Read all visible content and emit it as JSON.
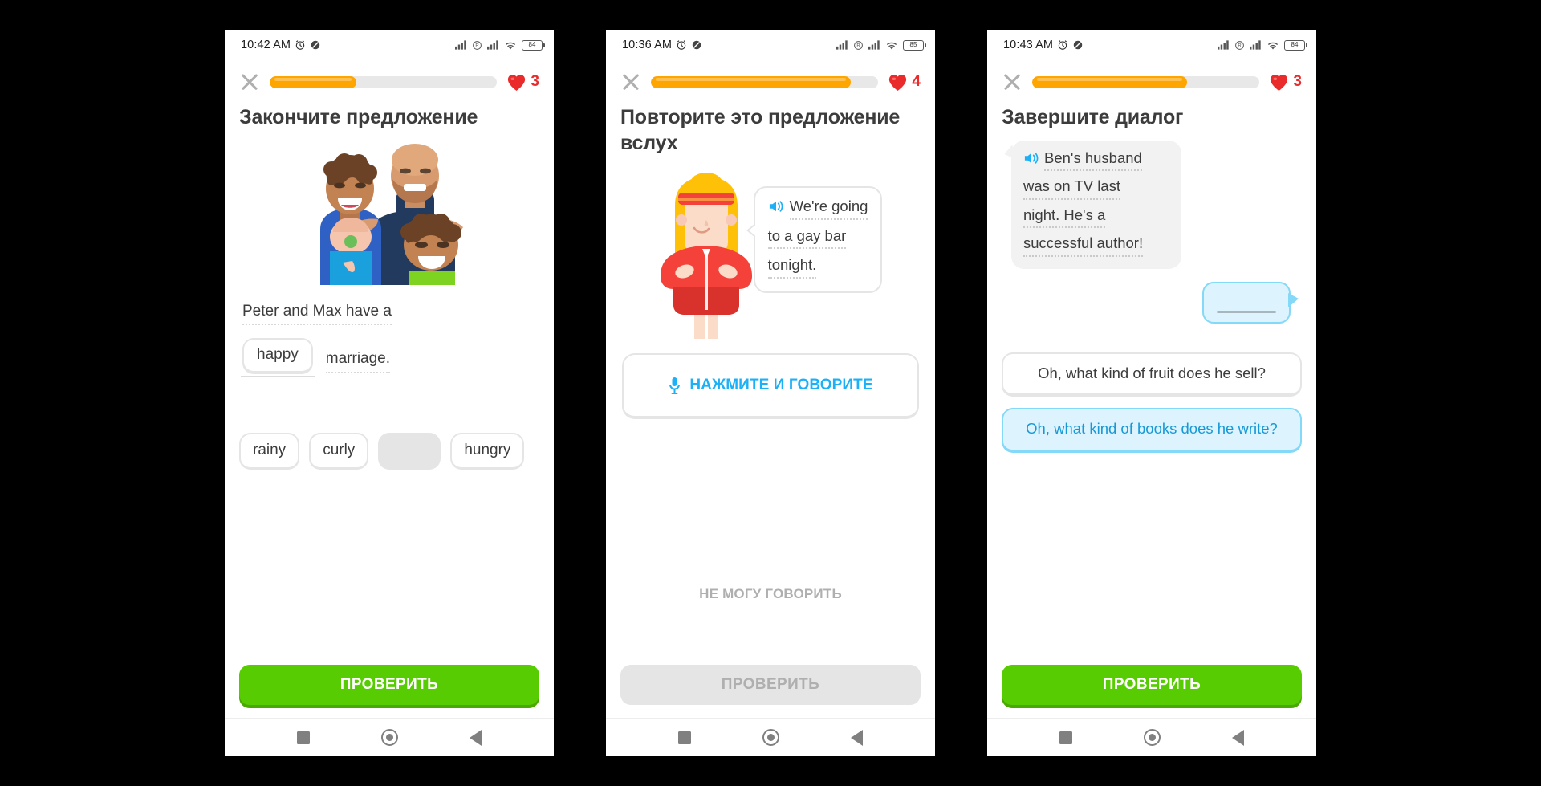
{
  "screens": [
    {
      "id": "complete-the-sentence",
      "status_bar": {
        "time": "10:42 AM",
        "alarm_icon": "alarm-icon",
        "dnd_icon": "do-not-disturb-icon",
        "signal_icon": "signal-bars-icon",
        "roaming_icon": "roaming-icon",
        "signal2_icon": "signal-bars-icon",
        "wifi_icon": "wifi-icon",
        "battery_level": "84"
      },
      "header": {
        "close_icon": "close-icon",
        "progress_percent": 38,
        "heart_icon": "heart-icon",
        "hearts": "3"
      },
      "title": "Закончите предложение",
      "illustration": "two-dads-with-two-children-illustration",
      "sentence": {
        "line1": "Peter and Max have a",
        "placed_word": "happy",
        "tail": "marriage."
      },
      "word_bank": [
        {
          "label": "rainy",
          "state": "available"
        },
        {
          "label": "curly",
          "state": "available"
        },
        {
          "label": "",
          "state": "used"
        },
        {
          "label": "hungry",
          "state": "available"
        }
      ],
      "cta": {
        "label": "ПРОВЕРИТЬ",
        "state": "enabled"
      }
    },
    {
      "id": "repeat-aloud",
      "status_bar": {
        "time": "10:36 AM",
        "alarm_icon": "alarm-icon",
        "dnd_icon": "do-not-disturb-icon",
        "signal_icon": "signal-bars-icon",
        "roaming_icon": "roaming-icon",
        "signal2_icon": "signal-bars-icon",
        "wifi_icon": "wifi-icon",
        "battery_level": "85"
      },
      "header": {
        "close_icon": "close-icon",
        "progress_percent": 88,
        "heart_icon": "heart-icon",
        "hearts": "4"
      },
      "title": "Повторите это предложение вслух",
      "illustration": "blonde-woman-in-red-jacket-illustration",
      "speech_bubble": {
        "speaker_icon": "speaker-icon",
        "lines": [
          "We're going",
          "to a gay bar",
          "tonight."
        ]
      },
      "mic_button": {
        "icon": "microphone-icon",
        "label": "НАЖМИТЕ И ГОВОРИТЕ"
      },
      "cant_speak_label": "НЕ МОГУ ГОВОРИТЬ",
      "cta": {
        "label": "ПРОВЕРИТЬ",
        "state": "disabled"
      }
    },
    {
      "id": "complete-the-dialogue",
      "status_bar": {
        "time": "10:43 AM",
        "alarm_icon": "alarm-icon",
        "dnd_icon": "do-not-disturb-icon",
        "signal_icon": "signal-bars-icon",
        "roaming_icon": "roaming-icon",
        "signal2_icon": "signal-bars-icon",
        "wifi_icon": "wifi-icon",
        "battery_level": "84"
      },
      "header": {
        "close_icon": "close-icon",
        "progress_percent": 68,
        "heart_icon": "heart-icon",
        "hearts": "3"
      },
      "title": "Завершите диалог",
      "dialogue": {
        "speaker_icon": "speaker-icon",
        "lines": [
          "Ben's husband",
          "was on TV last",
          "night. He's a",
          "successful author!"
        ]
      },
      "reply_placeholder": "blank-answer-bubble",
      "options": [
        {
          "label": "Oh, what kind of fruit does he sell?",
          "selected": false
        },
        {
          "label": "Oh, what kind of books does he write?",
          "selected": true
        }
      ],
      "cta": {
        "label": "ПРОВЕРИТЬ",
        "state": "enabled"
      }
    }
  ],
  "nav_bar": {
    "recents_icon": "recents-square-icon",
    "home_icon": "home-circle-icon",
    "back_icon": "back-triangle-icon"
  },
  "colors": {
    "progress": "#ffa500",
    "heart": "#ea2b2b",
    "cta_green": "#58cc02",
    "accent_blue": "#1cb0f6",
    "selected_bg": "#ddf4ff"
  }
}
